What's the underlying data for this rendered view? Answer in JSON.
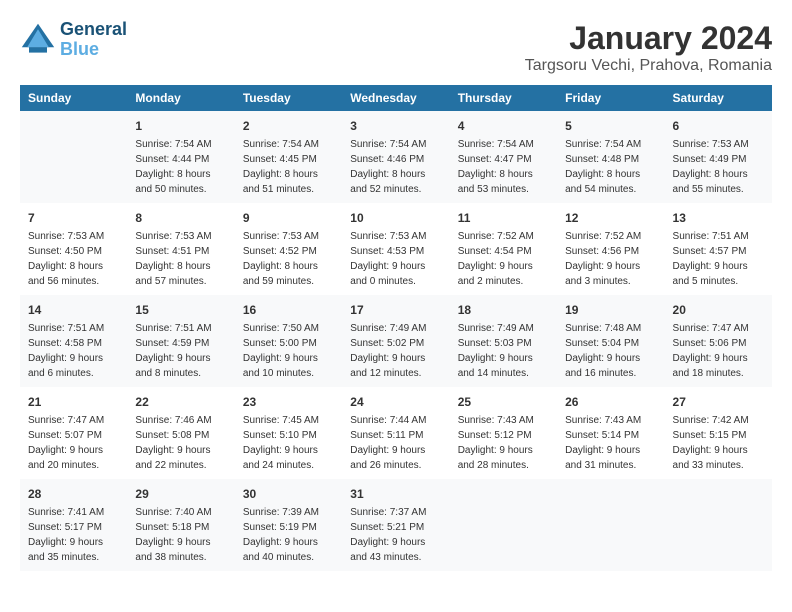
{
  "header": {
    "logo_line1": "General",
    "logo_line2": "Blue",
    "title": "January 2024",
    "subtitle": "Targsoru Vechi, Prahova, Romania"
  },
  "calendar": {
    "days_of_week": [
      "Sunday",
      "Monday",
      "Tuesday",
      "Wednesday",
      "Thursday",
      "Friday",
      "Saturday"
    ],
    "weeks": [
      [
        {
          "day": "",
          "info": ""
        },
        {
          "day": "1",
          "info": "Sunrise: 7:54 AM\nSunset: 4:44 PM\nDaylight: 8 hours\nand 50 minutes."
        },
        {
          "day": "2",
          "info": "Sunrise: 7:54 AM\nSunset: 4:45 PM\nDaylight: 8 hours\nand 51 minutes."
        },
        {
          "day": "3",
          "info": "Sunrise: 7:54 AM\nSunset: 4:46 PM\nDaylight: 8 hours\nand 52 minutes."
        },
        {
          "day": "4",
          "info": "Sunrise: 7:54 AM\nSunset: 4:47 PM\nDaylight: 8 hours\nand 53 minutes."
        },
        {
          "day": "5",
          "info": "Sunrise: 7:54 AM\nSunset: 4:48 PM\nDaylight: 8 hours\nand 54 minutes."
        },
        {
          "day": "6",
          "info": "Sunrise: 7:53 AM\nSunset: 4:49 PM\nDaylight: 8 hours\nand 55 minutes."
        }
      ],
      [
        {
          "day": "7",
          "info": "Sunrise: 7:53 AM\nSunset: 4:50 PM\nDaylight: 8 hours\nand 56 minutes."
        },
        {
          "day": "8",
          "info": "Sunrise: 7:53 AM\nSunset: 4:51 PM\nDaylight: 8 hours\nand 57 minutes."
        },
        {
          "day": "9",
          "info": "Sunrise: 7:53 AM\nSunset: 4:52 PM\nDaylight: 8 hours\nand 59 minutes."
        },
        {
          "day": "10",
          "info": "Sunrise: 7:53 AM\nSunset: 4:53 PM\nDaylight: 9 hours\nand 0 minutes."
        },
        {
          "day": "11",
          "info": "Sunrise: 7:52 AM\nSunset: 4:54 PM\nDaylight: 9 hours\nand 2 minutes."
        },
        {
          "day": "12",
          "info": "Sunrise: 7:52 AM\nSunset: 4:56 PM\nDaylight: 9 hours\nand 3 minutes."
        },
        {
          "day": "13",
          "info": "Sunrise: 7:51 AM\nSunset: 4:57 PM\nDaylight: 9 hours\nand 5 minutes."
        }
      ],
      [
        {
          "day": "14",
          "info": "Sunrise: 7:51 AM\nSunset: 4:58 PM\nDaylight: 9 hours\nand 6 minutes."
        },
        {
          "day": "15",
          "info": "Sunrise: 7:51 AM\nSunset: 4:59 PM\nDaylight: 9 hours\nand 8 minutes."
        },
        {
          "day": "16",
          "info": "Sunrise: 7:50 AM\nSunset: 5:00 PM\nDaylight: 9 hours\nand 10 minutes."
        },
        {
          "day": "17",
          "info": "Sunrise: 7:49 AM\nSunset: 5:02 PM\nDaylight: 9 hours\nand 12 minutes."
        },
        {
          "day": "18",
          "info": "Sunrise: 7:49 AM\nSunset: 5:03 PM\nDaylight: 9 hours\nand 14 minutes."
        },
        {
          "day": "19",
          "info": "Sunrise: 7:48 AM\nSunset: 5:04 PM\nDaylight: 9 hours\nand 16 minutes."
        },
        {
          "day": "20",
          "info": "Sunrise: 7:47 AM\nSunset: 5:06 PM\nDaylight: 9 hours\nand 18 minutes."
        }
      ],
      [
        {
          "day": "21",
          "info": "Sunrise: 7:47 AM\nSunset: 5:07 PM\nDaylight: 9 hours\nand 20 minutes."
        },
        {
          "day": "22",
          "info": "Sunrise: 7:46 AM\nSunset: 5:08 PM\nDaylight: 9 hours\nand 22 minutes."
        },
        {
          "day": "23",
          "info": "Sunrise: 7:45 AM\nSunset: 5:10 PM\nDaylight: 9 hours\nand 24 minutes."
        },
        {
          "day": "24",
          "info": "Sunrise: 7:44 AM\nSunset: 5:11 PM\nDaylight: 9 hours\nand 26 minutes."
        },
        {
          "day": "25",
          "info": "Sunrise: 7:43 AM\nSunset: 5:12 PM\nDaylight: 9 hours\nand 28 minutes."
        },
        {
          "day": "26",
          "info": "Sunrise: 7:43 AM\nSunset: 5:14 PM\nDaylight: 9 hours\nand 31 minutes."
        },
        {
          "day": "27",
          "info": "Sunrise: 7:42 AM\nSunset: 5:15 PM\nDaylight: 9 hours\nand 33 minutes."
        }
      ],
      [
        {
          "day": "28",
          "info": "Sunrise: 7:41 AM\nSunset: 5:17 PM\nDaylight: 9 hours\nand 35 minutes."
        },
        {
          "day": "29",
          "info": "Sunrise: 7:40 AM\nSunset: 5:18 PM\nDaylight: 9 hours\nand 38 minutes."
        },
        {
          "day": "30",
          "info": "Sunrise: 7:39 AM\nSunset: 5:19 PM\nDaylight: 9 hours\nand 40 minutes."
        },
        {
          "day": "31",
          "info": "Sunrise: 7:37 AM\nSunset: 5:21 PM\nDaylight: 9 hours\nand 43 minutes."
        },
        {
          "day": "",
          "info": ""
        },
        {
          "day": "",
          "info": ""
        },
        {
          "day": "",
          "info": ""
        }
      ]
    ]
  }
}
